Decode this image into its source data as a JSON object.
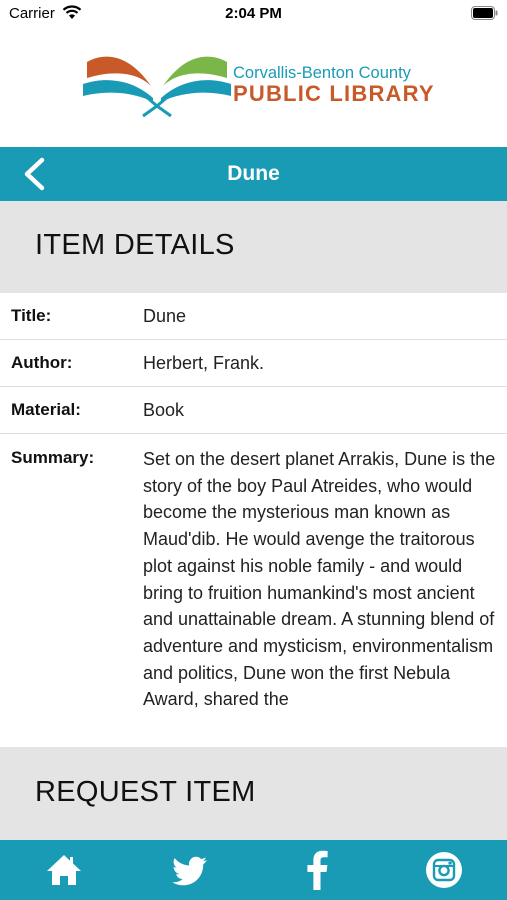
{
  "status_bar": {
    "carrier": "Carrier",
    "time": "2:04 PM"
  },
  "logo": {
    "line1": "Corvallis-Benton County",
    "line2": "PUBLIC LIBRARY"
  },
  "nav": {
    "title": "Dune",
    "back_icon": "chevron-left-icon"
  },
  "item_details": {
    "heading": "ITEM DETAILS",
    "rows": [
      {
        "label": "Title:",
        "value": "Dune"
      },
      {
        "label": "Author:",
        "value": "Herbert, Frank."
      },
      {
        "label": "Material:",
        "value": "Book"
      }
    ],
    "summary_label": "Summary:",
    "summary_text": "Set on the desert planet Arrakis, Dune is the story of the boy Paul Atreides, who would become the mysterious man known as Maud'dib. He would avenge the traitorous plot against his noble family - and would bring to fruition humankind's most ancient and unattainable dream. A stunning blend of adventure and mysticism, environmentalism and politics, Dune won the first Nebula Award, shared the"
  },
  "request": {
    "heading": "REQUEST ITEM"
  },
  "tab_bar": {
    "icons": [
      "home-icon",
      "twitter-icon",
      "facebook-icon",
      "instagram-icon"
    ]
  },
  "colors": {
    "brand_teal": "#1a9bb5",
    "brand_orange": "#c85a2a",
    "brand_green": "#7ab648",
    "header_gray": "#e4e4e4"
  }
}
